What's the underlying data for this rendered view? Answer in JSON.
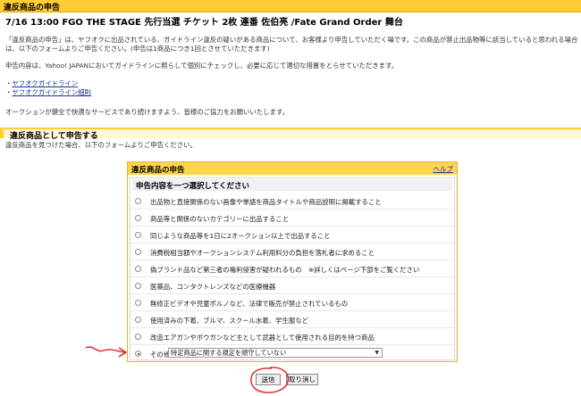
{
  "header": {
    "title": "違反商品の申告"
  },
  "item": {
    "title": "7/16 13:00 FGO THE STAGE 先行当選 チケット 2枚 連番 佐伯亮 /Fate Grand Order 舞台"
  },
  "intro": {
    "line1": "「違反商品の申告」は、ヤフオクに出品されている、ガイドライン違反の疑いがある商品について、お客様より申告していただく場です。この商品が禁止出品物等に該当していると思われる場合",
    "line2": "は、以下のフォームよりご申告ください。(申告は1商品につき1回とさせていただきます)",
    "line3": "申告内容は、Yahoo! JAPANにおいてガイドラインに照らして個別にチェックし、必要に応じて適切な措置をとらせていただきます。",
    "line4": "オークションが健全で快適なサービスであり続けますよう、皆様のご協力をお願いいたします。"
  },
  "links": [
    "ヤフオクガイドライン",
    "ヤフオクガイドライン細則"
  ],
  "section": {
    "title": "違反商品として申告する",
    "desc": "違反商品を見つけた場合、以下のフォームよりご申告ください。"
  },
  "form": {
    "title": "違反商品の申告",
    "help": "ヘルプ",
    "question": "申告内容を一つ選択してください",
    "options": [
      "出品物と直接関係のない画像や単語を商品タイトルや商品説明に掲載すること",
      "商品等と関係のないカテゴリーに出品すること",
      "同じような商品等を1日に2オークション以上で出品すること",
      "消費税相当額やオークションシステム利用料分の負担を落札者に求めること",
      "偽ブランド品など第三者の権利侵害が疑われるもの　※詳しくはページ下部をご覧ください",
      "医薬品、コンタクトレンズなどの医療機器",
      "無修正ビデオや児童ポルノなど、法律で販売が禁止されているもの",
      "使用済みの下着、ブルマ、スクール水着、学生服など",
      "改造エアガンやボウガンなど主として武器として使用される目的を持つ商品"
    ],
    "other_label": "その他",
    "other_select": "特定商品に関する規定を順守していない"
  },
  "buttons": {
    "submit": "送信",
    "cancel": "取り消し"
  },
  "colors": {
    "header": "#ffcc33",
    "link": "#1a3399",
    "annotation": "#e02020"
  }
}
